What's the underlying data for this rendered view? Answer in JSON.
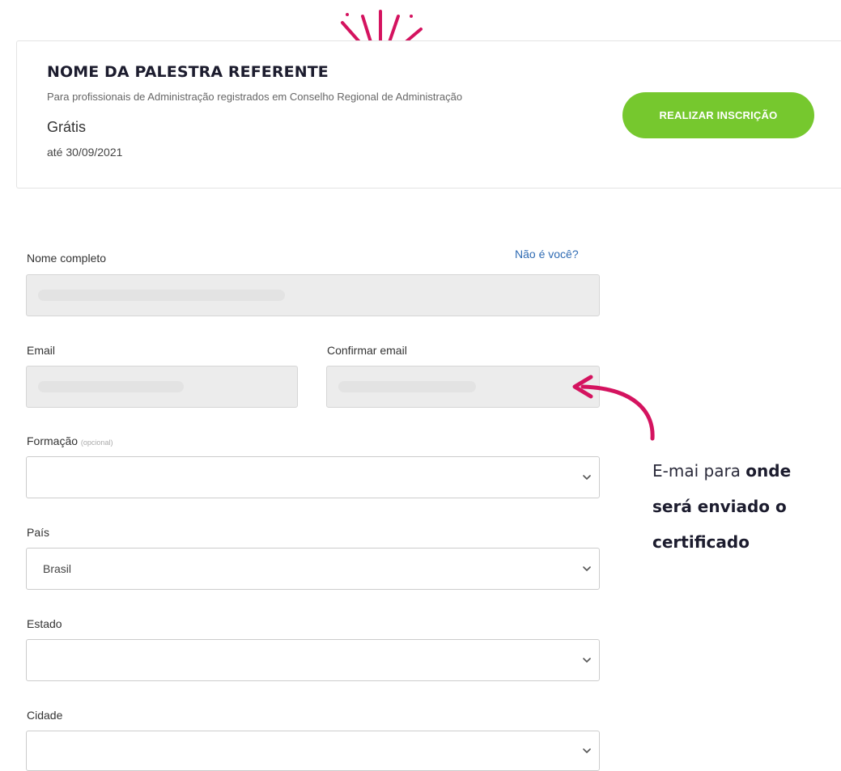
{
  "event": {
    "title": "NOME DA PALESTRA REFERENTE",
    "subtitle": "Para profissionais de Administração registrados em Conselho Regional de Administração",
    "price": "Grátis",
    "deadline": "até 30/09/2021",
    "register_label": "REALIZAR INSCRIÇÃO"
  },
  "form": {
    "full_name": {
      "label": "Nome completo",
      "value": ""
    },
    "not_you_link": "Não é você?",
    "email": {
      "label": "Email",
      "value": ""
    },
    "confirm_email": {
      "label": "Confirmar email",
      "value": ""
    },
    "education": {
      "label": "Formação",
      "optional_note": "(opcional)",
      "value": ""
    },
    "country": {
      "label": "País",
      "value": "Brasil"
    },
    "state": {
      "label": "Estado",
      "value": ""
    },
    "city": {
      "label": "Cidade",
      "value": ""
    }
  },
  "annotation": {
    "text_regular": "E-mai para ",
    "text_bold_1": "onde",
    "text_bold_2": "será enviado o",
    "text_bold_3": "certificado"
  },
  "colors": {
    "accent_green": "#76c82e",
    "annotation_magenta": "#d4135f",
    "link_blue": "#2f6bb3"
  },
  "icons": [
    "chevron-down-icon",
    "burst-decoration-icon",
    "curved-arrow-icon"
  ]
}
